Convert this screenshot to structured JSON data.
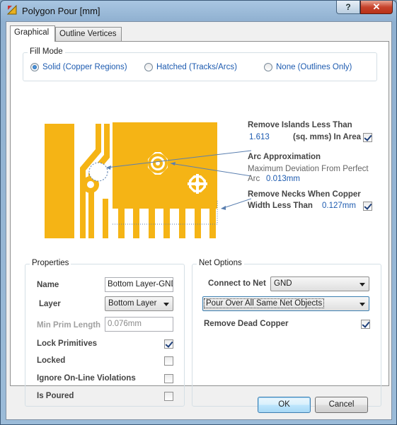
{
  "window": {
    "title": "Polygon Pour [mm]",
    "help_glyph": "?",
    "close_glyph": "✕"
  },
  "tabs": [
    {
      "label": "Graphical"
    },
    {
      "label": "Outline Vertices"
    }
  ],
  "fill_mode": {
    "title": "Fill Mode",
    "options": [
      {
        "label": "Solid (Copper Regions)",
        "selected": true
      },
      {
        "label": "Hatched (Tracks/Arcs)",
        "selected": false
      },
      {
        "label": "None (Outlines Only)",
        "selected": false
      }
    ]
  },
  "preview": {
    "copper_color": "#f5b415",
    "remove_islands": {
      "label": "Remove Islands Less Than",
      "value": "1.613",
      "unit": "(sq. mms) In Area",
      "checked": true
    },
    "arc_approx": {
      "label": "Arc Approximation",
      "desc": "Maximum Deviation From Perfect",
      "desc2": "Arc",
      "value": "0.013mm"
    },
    "remove_necks": {
      "label": "Remove Necks When Copper",
      "label2": "Width Less Than",
      "value": "0.127mm",
      "checked": true
    }
  },
  "properties": {
    "title": "Properties",
    "name_label": "Name",
    "name_value": "Bottom Layer-GND",
    "layer_label": "Layer",
    "layer_value": "Bottom Layer",
    "min_prim_label": "Min Prim Length",
    "min_prim_value": "0.076mm",
    "lock_primitives": {
      "label": "Lock Primitives",
      "checked": true
    },
    "locked": {
      "label": "Locked",
      "checked": false
    },
    "ignore_online": {
      "label": "Ignore On-Line Violations",
      "checked": false
    },
    "is_poured": {
      "label": "Is Poured",
      "checked": false
    }
  },
  "net_options": {
    "title": "Net Options",
    "connect_label": "Connect to Net",
    "connect_value": "GND",
    "pour_mode": "Pour Over All Same Net Objects",
    "remove_dead": {
      "label": "Remove Dead Copper",
      "checked": true
    }
  },
  "buttons": {
    "ok": "OK",
    "cancel": "Cancel"
  }
}
